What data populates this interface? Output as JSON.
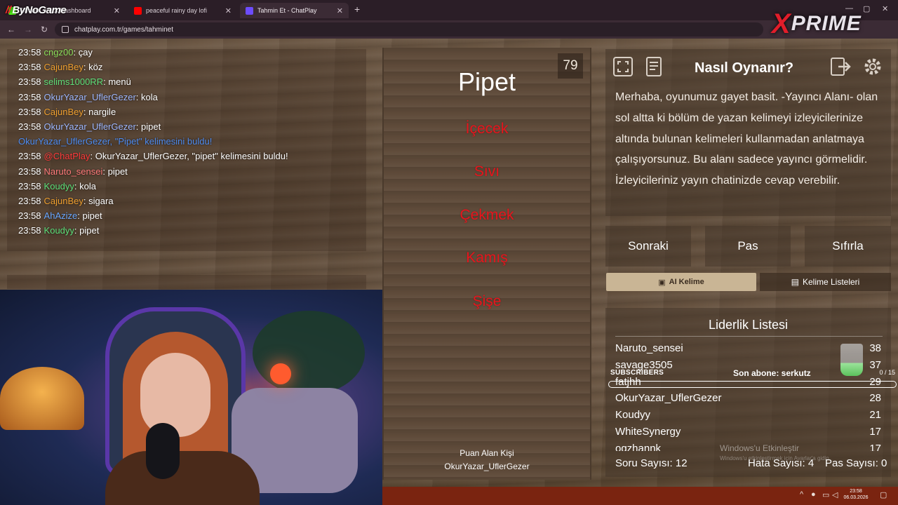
{
  "browser": {
    "tabs": [
      {
        "label": "Stream - Kick Dashboard",
        "active": false
      },
      {
        "label": "peaceful rainy day lofi",
        "active": false
      },
      {
        "label": "Tahmin Et - ChatPlay",
        "active": true
      }
    ],
    "url": "chatplay.com.tr/games/tahminet"
  },
  "overlay": {
    "streamer_logo": "ByNoGame",
    "brand_logo": "PRIME"
  },
  "chat": {
    "lines": [
      {
        "time": "23:58",
        "user": "cngz00",
        "message": ": çay",
        "user_color": "#8ee05c"
      },
      {
        "time": "23:58",
        "user": "CajunBey",
        "message": ": köz",
        "user_color": "#f0a030"
      },
      {
        "time": "23:58",
        "user": "selims1000RR",
        "message": ": menü",
        "user_color": "#60e07a"
      },
      {
        "time": "23:58",
        "user": "OkurYazar_UflerGezer",
        "message": ": kola",
        "user_color": "#9fb8ff"
      },
      {
        "time": "23:58",
        "user": "CajunBey",
        "message": ": nargile",
        "user_color": "#f0a030"
      },
      {
        "time": "23:58",
        "user": "OkurYazar_UflerGezer",
        "message": ": pipet",
        "user_color": "#9fb8ff"
      },
      {
        "time": "",
        "user": "OkurYazar_UflerGezer, \"Pipet\" kelimesini buldu!",
        "message": "",
        "user_color": "#4f8cf0"
      },
      {
        "time": "23:58",
        "user": "@ChatPlay",
        "message": ": OkurYazar_UflerGezer, \"pipet\" kelimesini buldu!",
        "user_color": "#ff3a3a"
      },
      {
        "time": "23:58",
        "user": "Naruto_sensei",
        "message": ": pipet",
        "user_color": "#ff7a7a"
      },
      {
        "time": "23:58",
        "user": "Koudyy",
        "message": ": kola",
        "user_color": "#5ee07a"
      },
      {
        "time": "23:58",
        "user": "CajunBey",
        "message": ": sigara",
        "user_color": "#f0a030"
      },
      {
        "time": "23:58",
        "user": "AhAzize",
        "message": ": pipet",
        "user_color": "#6aa8ff"
      },
      {
        "time": "23:58",
        "user": "Koudyy",
        "message": ": pipet",
        "user_color": "#5ee07a"
      }
    ]
  },
  "game": {
    "timer": "79",
    "word": "Pipet",
    "forbidden_words": [
      "İçecek",
      "Sıvı",
      "Çekmek",
      "Kamış",
      "Şişe"
    ],
    "scorer_label": "Puan Alan Kişi",
    "scorer_name": "OkurYazar_UflerGezer"
  },
  "how_to": {
    "title": "Nasıl Oynanır?",
    "text": "Merhaba, oyunumuz gayet basit. -Yayıncı Alanı- olan sol altta ki bölüm de yazan kelimeyi izleyicilerinize altında bulunan kelimeleri kullanmadan anlatmaya çalışıyorsunuz. Bu alanı sadece yayıncı görmelidir. İzleyicileriniz yayın chatinizde cevap verebilir."
  },
  "controls": {
    "next": "Sonraki",
    "pass": "Pas",
    "reset": "Sıfırla",
    "ai_word": "AI Kelime",
    "word_lists": "Kelime Listeleri"
  },
  "leaderboard": {
    "title": "Liderlik Listesi",
    "rows": [
      {
        "name": "Naruto_sensei",
        "score": "38"
      },
      {
        "name": "savage3505",
        "score": "37"
      },
      {
        "name": "fatjhh",
        "score": "29"
      },
      {
        "name": "OkurYazar_UflerGezer",
        "score": "28"
      },
      {
        "name": "Koudyy",
        "score": "21"
      },
      {
        "name": "WhiteSynergy",
        "score": "17"
      },
      {
        "name": "ogzhannk",
        "score": "17"
      }
    ],
    "question_count": "Soru Sayısı: 12",
    "error_count": "Hata Sayısı: 4",
    "pass_count": "Pas Sayısı: 0"
  },
  "subscriber_bar": {
    "label": "SUBSCRIBERS",
    "last_sub": "Son abone: serkutz",
    "count": "0 / 15"
  },
  "windows": {
    "activation": "Windows'u Etkinleştir",
    "activation_sub": "Windows'u etkinleştirmek için Ayarlar'a gidin.",
    "time": "23:58",
    "date": "06.03.2026"
  },
  "colors": {
    "forbidden": "#e8141c",
    "taskbar": "#7a2410",
    "wood": "#5e4a39"
  }
}
